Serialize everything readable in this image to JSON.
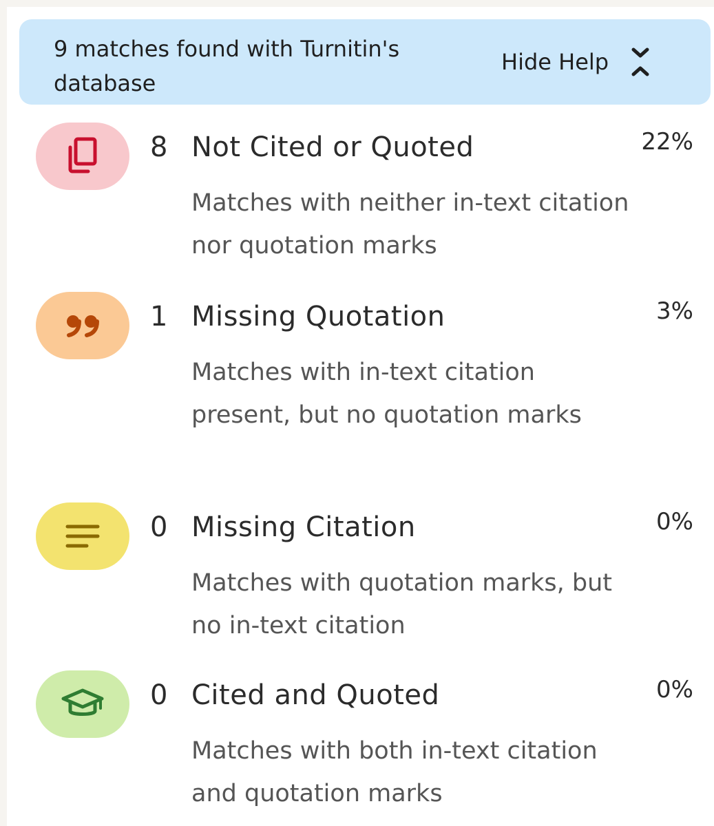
{
  "header": {
    "title": "9 matches found with Turnitin's database",
    "hide_help_label": "Hide Help",
    "hide_help_icon": "chevron-collapse-icon"
  },
  "categories": [
    {
      "count": "8",
      "title": "Not Cited or Quoted",
      "percent": "22%",
      "description": "Matches with neither in-text citation nor quotation marks",
      "icon": "copy-icon",
      "badge_color": "#f8c8cc",
      "icon_color": "#c8102e"
    },
    {
      "count": "1",
      "title": "Missing Quotation",
      "percent": "3%",
      "description": "Matches with in-text citation present, but no quotation marks",
      "icon": "quote-icon",
      "badge_color": "#fbc995",
      "icon_color": "#b54708"
    },
    {
      "count": "0",
      "title": "Missing Citation",
      "percent": "0%",
      "description": "Matches with quotation marks, but no in-text citation",
      "icon": "text-lines-icon",
      "badge_color": "#f3e36f",
      "icon_color": "#8a6a00"
    },
    {
      "count": "0",
      "title": "Cited and Quoted",
      "percent": "0%",
      "description": "Matches with both in-text citation and quotation marks",
      "icon": "graduation-cap-icon",
      "badge_color": "#cfecaa",
      "icon_color": "#2f7d32"
    }
  ]
}
